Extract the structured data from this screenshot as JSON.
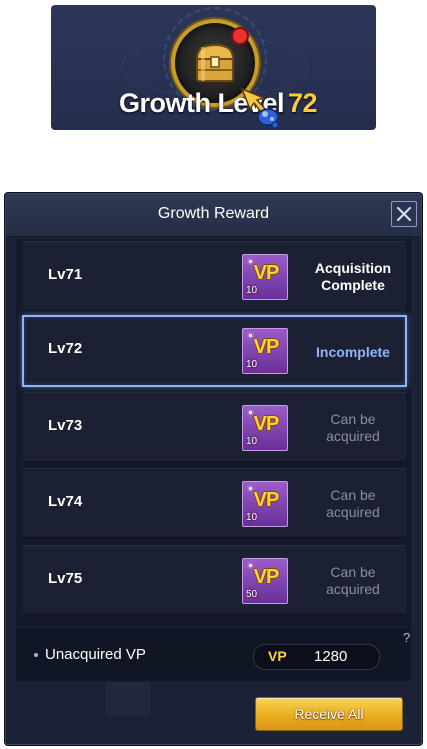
{
  "banner": {
    "label": "Growth Level",
    "level": "72"
  },
  "panel": {
    "title": "Growth Reward"
  },
  "rewards": [
    {
      "level": "Lv71",
      "icon_text": "VP",
      "quantity": "10",
      "status": "Acquisition Complete"
    },
    {
      "level": "Lv72",
      "icon_text": "VP",
      "quantity": "10",
      "status": "Incomplete"
    },
    {
      "level": "Lv73",
      "icon_text": "VP",
      "quantity": "10",
      "status": "Can be acquired"
    },
    {
      "level": "Lv74",
      "icon_text": "VP",
      "quantity": "10",
      "status": "Can be acquired"
    },
    {
      "level": "Lv75",
      "icon_text": "VP",
      "quantity": "50",
      "status": "Can be acquired"
    }
  ],
  "footer": {
    "unacquired_label": "Unacquired VP",
    "currency_label": "VP",
    "unacquired_value": "1280",
    "help": "?"
  },
  "actions": {
    "receive_all": "Receive All"
  },
  "colors": {
    "accent_blue": "#8fb4ff",
    "gold": "#ffd23a",
    "notification": "#e8332e"
  },
  "icons": [
    "treasure-chest-icon",
    "notification-dot-icon",
    "wand-cursor-icon",
    "close-icon",
    "vp-coupon-icon",
    "help-icon"
  ]
}
